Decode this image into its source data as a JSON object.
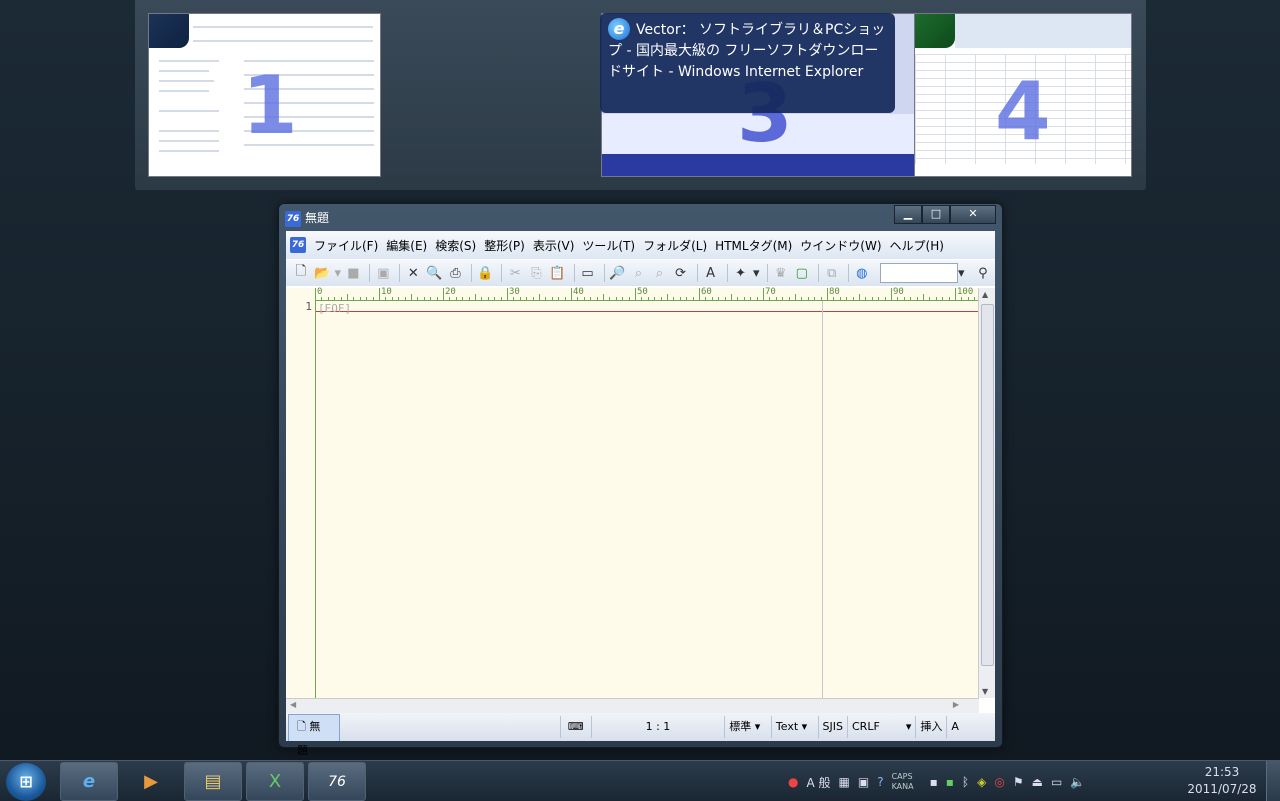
{
  "thumbnails": [
    {
      "number": "1",
      "kind": "explorer"
    },
    {
      "number": "3",
      "kind": "ie"
    },
    {
      "number": "4",
      "kind": "excel"
    }
  ],
  "thumb_tooltip": "Vector： ソフトライブラリ＆PCショップ - 国内最大級の フリーソフトダウンロードサイト - Windows Internet Explorer",
  "window": {
    "title": "無題",
    "buttons": {
      "minimize": "▁",
      "maximize": "□",
      "close": "✕"
    }
  },
  "menu": [
    "ファイル(F)",
    "編集(E)",
    "検索(S)",
    "整形(P)",
    "表示(V)",
    "ツール(T)",
    "フォルダ(L)",
    "HTMLタグ(M)",
    "ウインドウ(W)",
    "ヘルプ(H)"
  ],
  "editor": {
    "line_number": "1",
    "eof": "[EOF]",
    "ruler_labels": [
      "0",
      "10",
      "20",
      "30",
      "40",
      "50",
      "60",
      "70",
      "80",
      "90",
      "100"
    ]
  },
  "statusbar": {
    "tab": "無題",
    "position": "1 : 1",
    "mode": "標準",
    "type": "Text",
    "encoding": "SJIS",
    "newline": "CRLF",
    "insert": "挿入",
    "ime": "A"
  },
  "tray": {
    "caps": "CAPS",
    "kana": "KANA",
    "ime_mode": "A 般"
  },
  "clock": {
    "time": "21:53",
    "date": "2011/07/28"
  }
}
